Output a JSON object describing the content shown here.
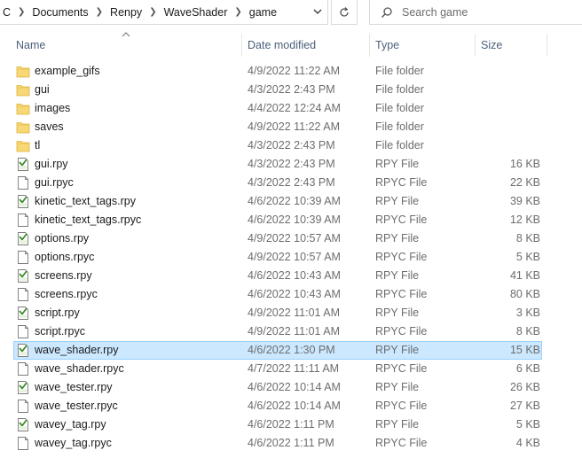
{
  "address_bar": {
    "crumbs": [
      "C",
      "Documents",
      "Renpy",
      "WaveShader",
      "game"
    ]
  },
  "search": {
    "placeholder": "Search game"
  },
  "columns": {
    "name": "Name",
    "date": "Date modified",
    "type": "Type",
    "size": "Size"
  },
  "files": [
    {
      "name": "example_gifs",
      "date": "4/9/2022 11:22 AM",
      "type": "File folder",
      "size": "",
      "icon": "folder-icon"
    },
    {
      "name": "gui",
      "date": "4/3/2022 2:43 PM",
      "type": "File folder",
      "size": "",
      "icon": "folder-icon"
    },
    {
      "name": "images",
      "date": "4/4/2022 12:24 AM",
      "type": "File folder",
      "size": "",
      "icon": "folder-icon"
    },
    {
      "name": "saves",
      "date": "4/9/2022 11:22 AM",
      "type": "File folder",
      "size": "",
      "icon": "folder-icon"
    },
    {
      "name": "tl",
      "date": "4/3/2022 2:43 PM",
      "type": "File folder",
      "size": "",
      "icon": "folder-icon"
    },
    {
      "name": "gui.rpy",
      "date": "4/3/2022 2:43 PM",
      "type": "RPY File",
      "size": "16 KB",
      "icon": "rpy-file-icon"
    },
    {
      "name": "gui.rpyc",
      "date": "4/3/2022 2:43 PM",
      "type": "RPYC File",
      "size": "22 KB",
      "icon": "blank-file-icon"
    },
    {
      "name": "kinetic_text_tags.rpy",
      "date": "4/6/2022 10:39 AM",
      "type": "RPY File",
      "size": "39 KB",
      "icon": "rpy-file-icon"
    },
    {
      "name": "kinetic_text_tags.rpyc",
      "date": "4/6/2022 10:39 AM",
      "type": "RPYC File",
      "size": "12 KB",
      "icon": "blank-file-icon"
    },
    {
      "name": "options.rpy",
      "date": "4/9/2022 10:57 AM",
      "type": "RPY File",
      "size": "8 KB",
      "icon": "rpy-file-icon"
    },
    {
      "name": "options.rpyc",
      "date": "4/9/2022 10:57 AM",
      "type": "RPYC File",
      "size": "5 KB",
      "icon": "blank-file-icon"
    },
    {
      "name": "screens.rpy",
      "date": "4/6/2022 10:43 AM",
      "type": "RPY File",
      "size": "41 KB",
      "icon": "rpy-file-icon"
    },
    {
      "name": "screens.rpyc",
      "date": "4/6/2022 10:43 AM",
      "type": "RPYC File",
      "size": "80 KB",
      "icon": "blank-file-icon"
    },
    {
      "name": "script.rpy",
      "date": "4/9/2022 11:01 AM",
      "type": "RPY File",
      "size": "3 KB",
      "icon": "rpy-file-icon"
    },
    {
      "name": "script.rpyc",
      "date": "4/9/2022 11:01 AM",
      "type": "RPYC File",
      "size": "8 KB",
      "icon": "blank-file-icon"
    },
    {
      "name": "wave_shader.rpy",
      "date": "4/6/2022 1:30 PM",
      "type": "RPY File",
      "size": "15 KB",
      "icon": "rpy-file-icon",
      "selected": true
    },
    {
      "name": "wave_shader.rpyc",
      "date": "4/7/2022 11:11 AM",
      "type": "RPYC File",
      "size": "6 KB",
      "icon": "blank-file-icon"
    },
    {
      "name": "wave_tester.rpy",
      "date": "4/6/2022 10:14 AM",
      "type": "RPY File",
      "size": "26 KB",
      "icon": "rpy-file-icon"
    },
    {
      "name": "wave_tester.rpyc",
      "date": "4/6/2022 10:14 AM",
      "type": "RPYC File",
      "size": "27 KB",
      "icon": "blank-file-icon"
    },
    {
      "name": "wavey_tag.rpy",
      "date": "4/6/2022 1:11 PM",
      "type": "RPY File",
      "size": "5 KB",
      "icon": "rpy-file-icon"
    },
    {
      "name": "wavey_tag.rpyc",
      "date": "4/6/2022 1:11 PM",
      "type": "RPYC File",
      "size": "4 KB",
      "icon": "blank-file-icon"
    }
  ],
  "colors": {
    "selected_bg": "#cce8ff",
    "selected_border": "#99d1ff",
    "header_text": "#4c607a",
    "folder": "#f8d775"
  }
}
